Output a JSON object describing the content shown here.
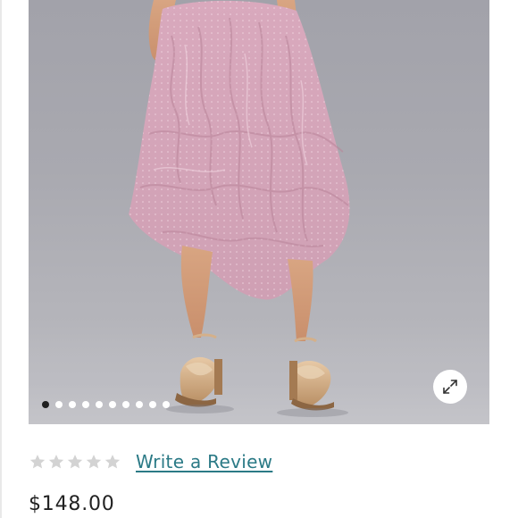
{
  "product_gallery": {
    "image_alt": "Pink ruffled tulle midi skirt with metallic bow heels",
    "image_count": 10,
    "active_index": 0,
    "expand_icon": "expand-icon"
  },
  "rating": {
    "stars_filled": 0,
    "stars_total": 5,
    "star_icon": "star-icon",
    "star_color": "#d3d3d3",
    "write_review_label": "Write a Review",
    "link_color": "#2b7a86"
  },
  "price": "$148.00"
}
